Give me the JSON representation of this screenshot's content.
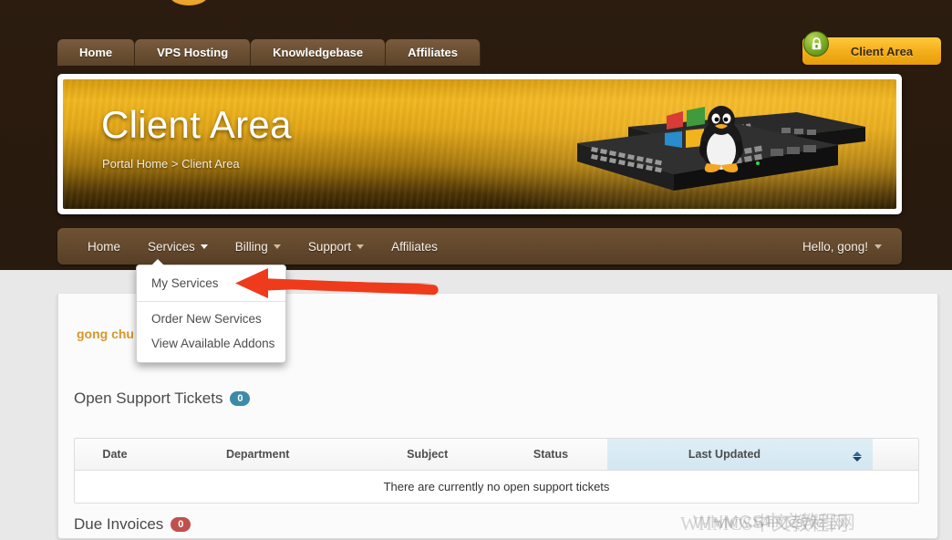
{
  "top_nav": {
    "tabs": [
      {
        "label": "Home"
      },
      {
        "label": "VPS Hosting"
      },
      {
        "label": "Knowledgebase"
      },
      {
        "label": "Affiliates"
      }
    ],
    "client_area_button": {
      "label": "Client Area",
      "icon": "lock-icon"
    }
  },
  "banner": {
    "title": "Client Area",
    "breadcrumb": "Portal Home > Client Area",
    "art": "server-windows-linux-image"
  },
  "main_nav": {
    "items": [
      {
        "label": "Home",
        "has_caret": false
      },
      {
        "label": "Services",
        "has_caret": true,
        "active": true
      },
      {
        "label": "Billing",
        "has_caret": true
      },
      {
        "label": "Support",
        "has_caret": true
      },
      {
        "label": "Affiliates",
        "has_caret": false
      }
    ],
    "user_menu": {
      "label": "Hello, gong!",
      "has_caret": true
    }
  },
  "services_dropdown": {
    "items": [
      {
        "label": "My Services"
      },
      {
        "label": "Order New Services"
      },
      {
        "label": "View Available Addons"
      }
    ]
  },
  "content": {
    "greeting": "gong chu",
    "tickets_section": {
      "heading": "Open Support Tickets",
      "badge": "0",
      "badge_color": "#3d8aa8",
      "columns": [
        "Date",
        "Department",
        "Subject",
        "Status",
        "Last Updated"
      ],
      "sorted_column": "Last Updated",
      "empty_message": "There are currently no open support tickets",
      "rows": []
    },
    "invoices_section": {
      "heading": "Due Invoices",
      "badge": "0",
      "badge_color": "#c0504d"
    }
  },
  "watermark": {
    "line_a": "WHMCS中文教程网",
    "line_b": "WHMCS中文教程网",
    "line_c": "www.whmcs.vc"
  },
  "colors": {
    "header_dark": "#2a1b0e",
    "nav_brown": "#64492d",
    "accent_gold": "#f5b01d",
    "greeting_gold": "#d7962a",
    "arrow_red": "#ee3b1c"
  }
}
